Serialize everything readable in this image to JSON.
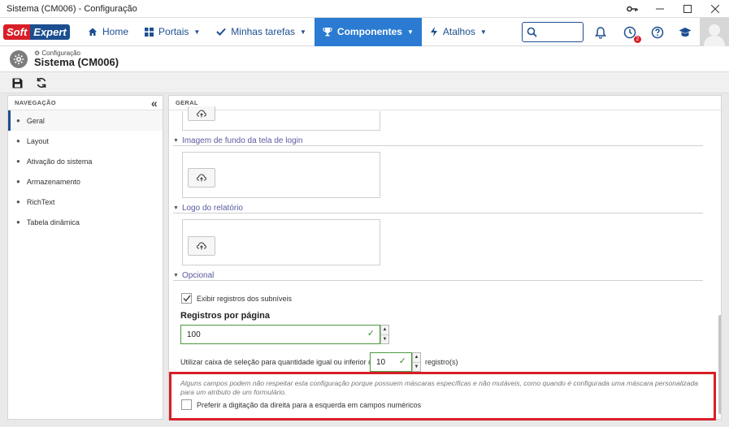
{
  "window": {
    "title": "Sistema (CM006) - Configuração"
  },
  "navbar": {
    "logo_soft": "Soft",
    "logo_expert": "Expert",
    "items": [
      {
        "label": "Home",
        "icon": "home-icon"
      },
      {
        "label": "Portais",
        "icon": "grid-icon"
      },
      {
        "label": "Minhas tarefas",
        "icon": "check-icon"
      },
      {
        "label": "Componentes",
        "icon": "trophy-icon"
      },
      {
        "label": "Atalhos",
        "icon": "bolt-icon"
      }
    ],
    "notification_badge": "2"
  },
  "page": {
    "breadcrumb": "Configuração",
    "title": "Sistema (CM006)"
  },
  "sidebar": {
    "header": "NAVEGAÇÃO",
    "items": [
      "Geral",
      "Layout",
      "Ativação do sistema",
      "Armazenamento",
      "RichText",
      "Tabela dinâmica"
    ]
  },
  "main": {
    "header": "GERAL",
    "section_login_bg": "Imagem de fundo da tela de login",
    "section_report_logo": "Logo do relatório",
    "section_optional": "Opcional",
    "show_subrecords_label": "Exibir registros dos subníveis",
    "records_per_page_label": "Registros por página",
    "records_per_page_value": "100",
    "checkbox_threshold_label": "Utilizar caixa de seleção para quantidade igual ou inferior que",
    "checkbox_threshold_value": "10",
    "checkbox_threshold_suffix": "registro(s)",
    "note_text": "Alguns campos podem não respeitar esta configuração porque possuem máscaras específicas e não mutáveis, como quando é configurada uma máscara personalizada para um atributo de um formulário.",
    "rtl_numeric_label": "Preferir a digitação da direita para a esquerda em campos numéricos"
  },
  "colors": {
    "brand_blue": "#1c4f8f",
    "active_nav": "#2a7bd1",
    "highlight_red": "#d81e27",
    "valid_green": "#4c9a3c"
  }
}
